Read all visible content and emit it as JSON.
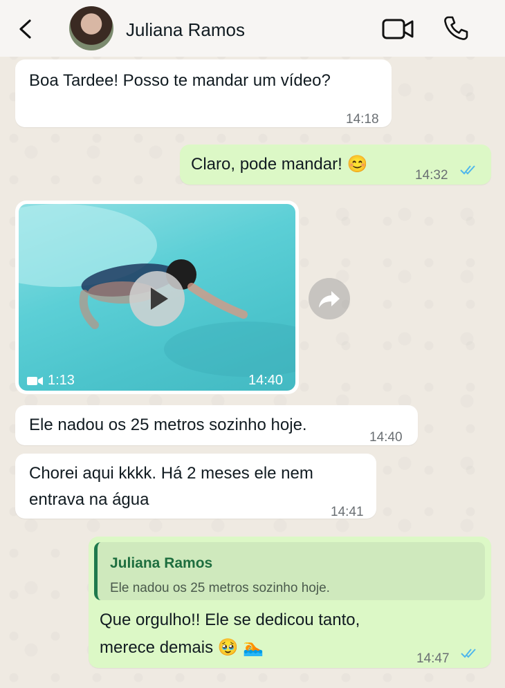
{
  "header": {
    "contact_name": "Juliana Ramos",
    "icons": [
      "back-arrow-icon",
      "avatar",
      "video-call-icon",
      "voice-call-icon"
    ]
  },
  "messages": [
    {
      "direction": "incoming",
      "type": "text",
      "text": "Boa Tardee! Posso te mandar um vídeo?",
      "time": "14:18"
    },
    {
      "direction": "outgoing",
      "type": "text",
      "text": "Claro, pode mandar! 😊",
      "time": "14:32",
      "status": "read"
    },
    {
      "direction": "incoming",
      "type": "video",
      "duration": "1:13",
      "time": "14:40"
    },
    {
      "direction": "incoming",
      "type": "text",
      "text": "Ele nadou os 25 metros sozinho hoje.",
      "time": "14:40"
    },
    {
      "direction": "incoming",
      "type": "text",
      "text_line1": "Chorei aqui kkkk. Há 2 meses ele nem",
      "text_line2": "entrava na água",
      "time": "14:41"
    },
    {
      "direction": "outgoing",
      "type": "reply",
      "quoted_name": "Juliana Ramos",
      "quoted_text": "Ele nadou os 25 metros sozinho hoje.",
      "text_line1": "Que orgulho!! Ele se dedicou tanto,",
      "text_line2": "merece demais 🥹 🏊",
      "time": "14:47",
      "status": "read"
    }
  ],
  "colors": {
    "outgoing_bubble": "#dcf8c6",
    "incoming_bubble": "#ffffff",
    "read_ticks": "#4fb6ec",
    "reply_accent": "#1f7a4d"
  }
}
